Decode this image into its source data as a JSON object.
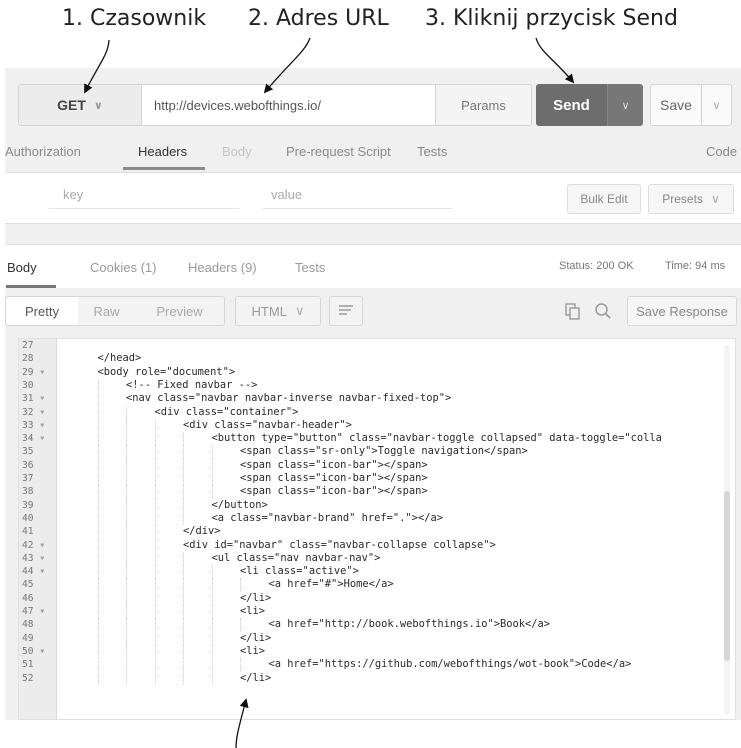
{
  "annotations": {
    "a1": "1. Czasownik",
    "a2": "2. Adres URL",
    "a3": "3. Kliknij przycisk Send"
  },
  "request": {
    "method": "GET",
    "url": "http://devices.webofthings.io/",
    "params": "Params",
    "send": "Send",
    "save": "Save"
  },
  "request_tabs": [
    "Authorization",
    "Headers",
    "Body",
    "Pre-request Script",
    "Tests",
    "Code"
  ],
  "kv": {
    "key_placeholder": "key",
    "value_placeholder": "value",
    "bulk_edit": "Bulk Edit",
    "presets": "Presets"
  },
  "response": {
    "tabs": [
      "Body",
      "Cookies (1)",
      "Headers (9)",
      "Tests"
    ],
    "status": "Status: 200 OK",
    "time": "Time: 94 ms",
    "view_modes": [
      "Pretty",
      "Raw",
      "Preview"
    ],
    "language": "HTML",
    "save_response": "Save Response"
  },
  "icons": {
    "chevron": "chevron-down-icon",
    "wrap": "wrap-lines-icon",
    "copy": "copy-icon",
    "search": "search-icon"
  },
  "colors": {
    "send_bg": "#6d6d6d",
    "panel_bg": "#f0f0f0"
  },
  "code_lines": [
    {
      "n": "27",
      "fold": "",
      "ind": 0,
      "t": ""
    },
    {
      "n": "28",
      "fold": "",
      "ind": 1,
      "t": "</head>"
    },
    {
      "n": "29",
      "fold": "▾",
      "ind": 1,
      "t": "<body role=\"document\">"
    },
    {
      "n": "30",
      "fold": "",
      "ind": 2,
      "t": "<!-- Fixed navbar -->"
    },
    {
      "n": "31",
      "fold": "▾",
      "ind": 2,
      "t": "<nav class=\"navbar navbar-inverse navbar-fixed-top\">"
    },
    {
      "n": "32",
      "fold": "▾",
      "ind": 3,
      "t": "<div class=\"container\">"
    },
    {
      "n": "33",
      "fold": "▾",
      "ind": 4,
      "t": "<div class=\"navbar-header\">"
    },
    {
      "n": "34",
      "fold": "▾",
      "ind": 5,
      "t": "<button type=\"button\" class=\"navbar-toggle collapsed\" data-toggle=\"colla"
    },
    {
      "n": "35",
      "fold": "",
      "ind": 6,
      "t": "<span class=\"sr-only\">Toggle navigation</span>"
    },
    {
      "n": "36",
      "fold": "",
      "ind": 6,
      "t": "<span class=\"icon-bar\"></span>"
    },
    {
      "n": "37",
      "fold": "",
      "ind": 6,
      "t": "<span class=\"icon-bar\"></span>"
    },
    {
      "n": "38",
      "fold": "",
      "ind": 6,
      "t": "<span class=\"icon-bar\"></span>"
    },
    {
      "n": "39",
      "fold": "",
      "ind": 5,
      "t": "</button>"
    },
    {
      "n": "40",
      "fold": "",
      "ind": 5,
      "t": "<a class=\"navbar-brand\" href=\".\"></a>"
    },
    {
      "n": "41",
      "fold": "",
      "ind": 4,
      "t": "</div>"
    },
    {
      "n": "42",
      "fold": "▾",
      "ind": 4,
      "t": "<div id=\"navbar\" class=\"navbar-collapse collapse\">"
    },
    {
      "n": "43",
      "fold": "▾",
      "ind": 5,
      "t": "<ul class=\"nav navbar-nav\">"
    },
    {
      "n": "44",
      "fold": "▾",
      "ind": 6,
      "t": "<li class=\"active\">"
    },
    {
      "n": "45",
      "fold": "",
      "ind": 7,
      "t": "<a href=\"#\">Home</a>"
    },
    {
      "n": "46",
      "fold": "",
      "ind": 6,
      "t": "</li>"
    },
    {
      "n": "47",
      "fold": "▾",
      "ind": 6,
      "t": "<li>"
    },
    {
      "n": "48",
      "fold": "",
      "ind": 7,
      "t": "<a href=\"http://book.webofthings.io\">Book</a>"
    },
    {
      "n": "49",
      "fold": "",
      "ind": 6,
      "t": "</li>"
    },
    {
      "n": "50",
      "fold": "▾",
      "ind": 6,
      "t": "<li>"
    },
    {
      "n": "51",
      "fold": "",
      "ind": 7,
      "t": "<a href=\"https://github.com/webofthings/wot-book\">Code</a>"
    },
    {
      "n": "52",
      "fold": "",
      "ind": 6,
      "t": "</li>"
    }
  ]
}
